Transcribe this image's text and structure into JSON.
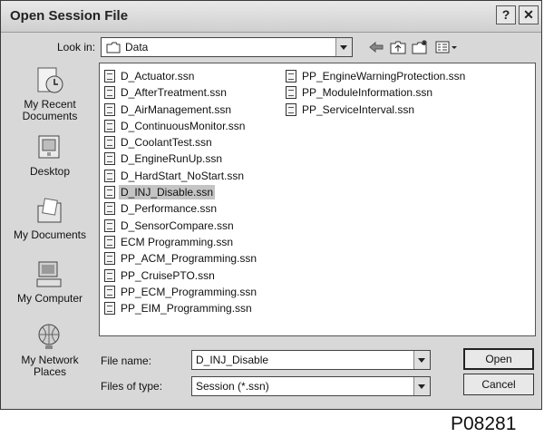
{
  "window": {
    "title": "Open Session File",
    "help_glyph": "?",
    "close_glyph": "✕"
  },
  "lookin": {
    "label": "Look in:",
    "value": "Data"
  },
  "toolbar": {
    "icons": [
      "back-icon",
      "up-folder-icon",
      "new-folder-icon",
      "view-menu-icon"
    ]
  },
  "places": [
    {
      "label": "My Recent Documents",
      "icon": "recent-documents-icon"
    },
    {
      "label": "Desktop",
      "icon": "desktop-icon"
    },
    {
      "label": "My Documents",
      "icon": "my-documents-icon"
    },
    {
      "label": "My Computer",
      "icon": "my-computer-icon"
    },
    {
      "label": "My Network Places",
      "icon": "network-places-icon"
    }
  ],
  "files_col1": [
    "D_Actuator.ssn",
    "D_AfterTreatment.ssn",
    "D_AirManagement.ssn",
    "D_ContinuousMonitor.ssn",
    "D_CoolantTest.ssn",
    "D_EngineRunUp.ssn",
    "D_HardStart_NoStart.ssn",
    "D_INJ_Disable.ssn",
    "D_Performance.ssn",
    "D_SensorCompare.ssn",
    "ECM Programming.ssn",
    "PP_ACM_Programming.ssn",
    "PP_CruisePTO.ssn",
    "PP_ECM_Programming.ssn",
    "PP_EIM_Programming.ssn"
  ],
  "files_col2": [
    "PP_EngineWarningProtection.ssn",
    "PP_ModuleInformation.ssn",
    "PP_ServiceInterval.ssn"
  ],
  "selected_file": "D_INJ_Disable.ssn",
  "filename": {
    "label": "File name:",
    "value": "D_INJ_Disable"
  },
  "filetype": {
    "label": "Files of type:",
    "value": "Session (*.ssn)"
  },
  "buttons": {
    "open": "Open",
    "cancel": "Cancel"
  },
  "figure_code": "P08281"
}
